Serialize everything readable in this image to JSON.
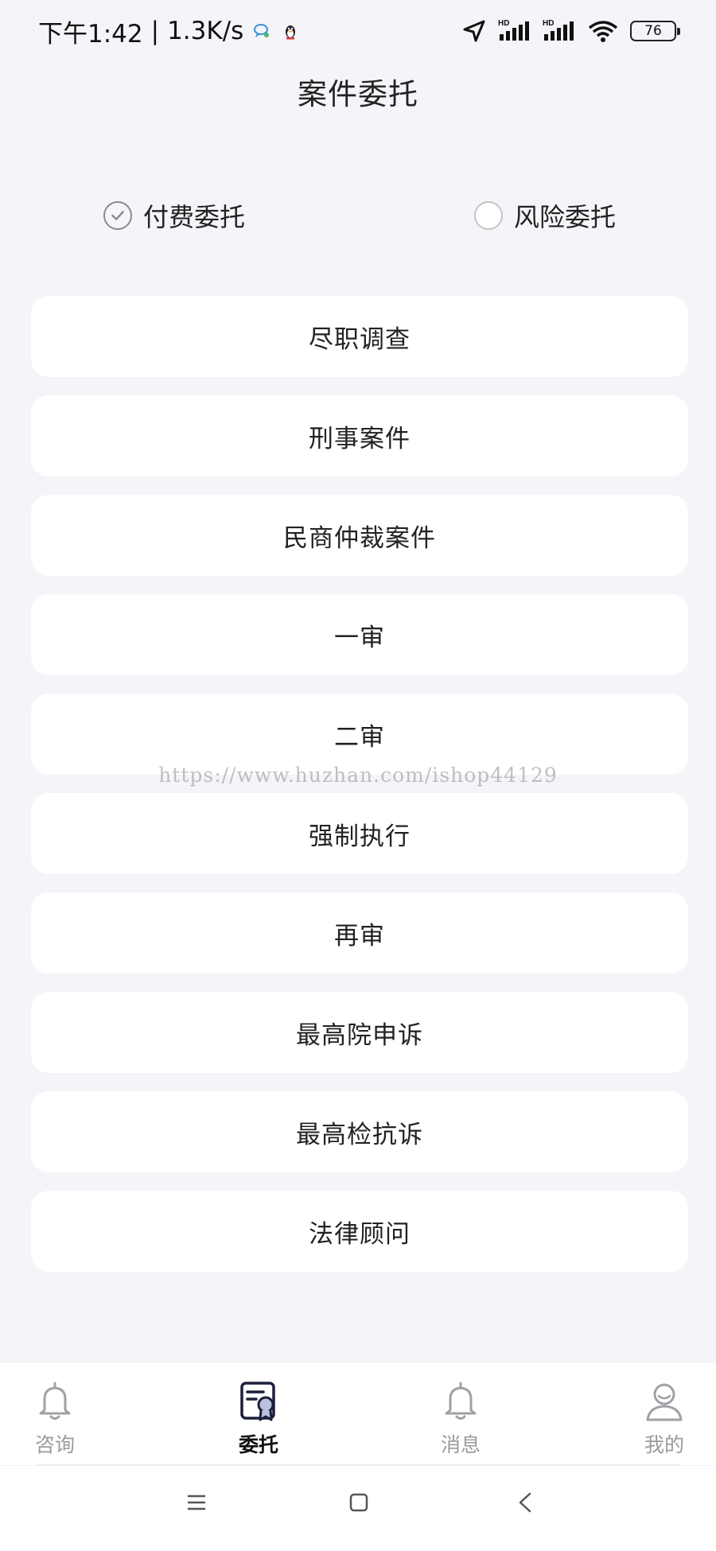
{
  "status_bar": {
    "time": "下午1:42",
    "separator": "|",
    "speed": "1.3K/s",
    "battery": "76",
    "icons": [
      "chat-bubble-icon",
      "penguin-icon",
      "location-arrow-icon",
      "signal-hd-icon",
      "signal-hd-icon",
      "wifi-icon",
      "battery-icon"
    ]
  },
  "header": {
    "title": "案件委托"
  },
  "delegation_type": {
    "options": [
      {
        "label": "付费委托",
        "checked": true
      },
      {
        "label": "风险委托",
        "checked": false
      }
    ]
  },
  "case_types": {
    "items": [
      {
        "label": "尽职调查"
      },
      {
        "label": "刑事案件"
      },
      {
        "label": "民商仲裁案件"
      },
      {
        "label": "一审"
      },
      {
        "label": "二审"
      },
      {
        "label": "强制执行"
      },
      {
        "label": "再审"
      },
      {
        "label": "最高院申诉"
      },
      {
        "label": "最高检抗诉"
      },
      {
        "label": "法律顾问"
      }
    ]
  },
  "watermark": "https://www.huzhan.com/ishop44129",
  "tab_bar": {
    "tabs": [
      {
        "label": "咨询",
        "icon": "bell-icon",
        "active": false
      },
      {
        "label": "委托",
        "icon": "certificate-icon",
        "active": true
      },
      {
        "label": "消息",
        "icon": "bell-icon",
        "active": false
      },
      {
        "label": "我的",
        "icon": "user-icon",
        "active": false
      }
    ]
  },
  "colors": {
    "background": "#f4f4f9",
    "card": "#ffffff",
    "text": "#222222",
    "inactive": "#9a9aa0",
    "active_icon_accent": "#b9c0e0"
  }
}
